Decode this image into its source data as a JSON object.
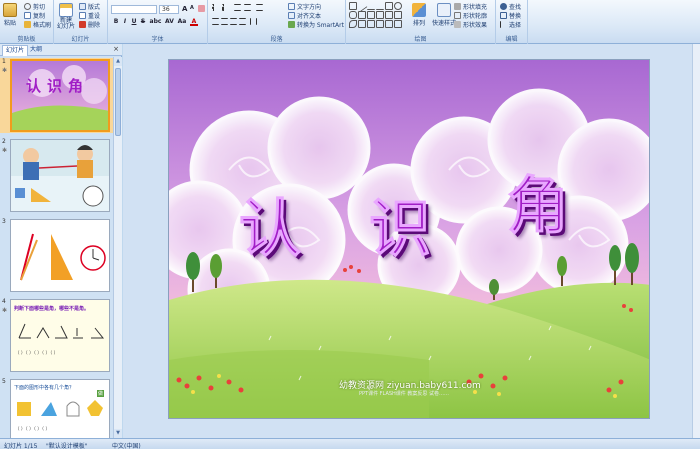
{
  "ribbon": {
    "clipboard": {
      "paste": "粘贴",
      "cut": "剪切",
      "copy": "复制",
      "format_painter": "格式刷",
      "label": "剪贴板"
    },
    "slides": {
      "new_slide": "新建\n幻灯片",
      "layout": "版式",
      "reset": "重设",
      "delete": "删除",
      "label": "幻灯片"
    },
    "font": {
      "font_name": "",
      "font_size": "36",
      "bold": "B",
      "italic": "I",
      "underline": "U",
      "strike": "S",
      "shadow": "abc",
      "spacing": "AV",
      "case": "Aa",
      "color": "A",
      "label": "字体"
    },
    "paragraph": {
      "text_direction": "文字方向",
      "align_text": "对齐文本",
      "smartart": "转换为 SmartArt",
      "label": "段落"
    },
    "drawing": {
      "arrange": "排列",
      "quick_styles": "快速样式",
      "shape_fill": "形状填充",
      "shape_outline": "形状轮廓",
      "shape_effects": "形状效果",
      "label": "绘图"
    },
    "editing": {
      "find": "查找",
      "replace": "替换",
      "select": "选择",
      "label": "编辑"
    }
  },
  "left_panel": {
    "tab_slides": "幻灯片",
    "tab_outline": "大纲",
    "close": "×",
    "slides": [
      {
        "number": "1",
        "title": "认识角"
      },
      {
        "number": "2",
        "title": ""
      },
      {
        "number": "3",
        "title": ""
      },
      {
        "number": "4",
        "title": "判断下面哪些是角，哪些不是角。"
      },
      {
        "number": "5",
        "title": "下面的图形中各有几个角？"
      }
    ],
    "slide4_answers": "（  ）（  ）（  ）（  ）（  ）",
    "slide5_answers": "（ ）（ ）（ ）（ ）",
    "slide5_badge": "做"
  },
  "slide": {
    "title_chars": [
      "认",
      "识",
      "角"
    ],
    "watermark": "幼教资源网  ziyuan.baby611.com",
    "watermark_sub": "PPT课件  FLASH课件  教案反思  试卷……"
  },
  "status": {
    "slide_indicator": "幻灯片 1/15",
    "theme": "\"默认设计模板\"",
    "language": "中文(中国)"
  },
  "colors": {
    "title_purple": "#a11ec6",
    "sky_top": "#b57ad8",
    "hill_green": "#a5d35a",
    "selection_orange": "#f29b1d"
  }
}
